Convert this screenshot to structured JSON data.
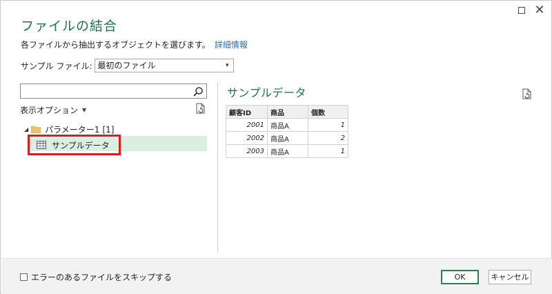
{
  "window": {
    "maximize_icon": "maximize-icon",
    "close_icon": "close-icon",
    "close_glyph": "✕"
  },
  "title": "ファイルの結合",
  "description": {
    "text": "各ファイルから抽出するオブジェクトを選びます。",
    "link": "詳細情報"
  },
  "sample_file": {
    "label": "サンプル ファイル:",
    "value": "最初のファイル",
    "caret": "▾"
  },
  "search": {
    "value": "",
    "placeholder": "",
    "icon": "search-icon"
  },
  "display_options": {
    "label": "表示オプション",
    "caret": "▼"
  },
  "tree": {
    "folder": {
      "label": "パラメーター1",
      "count": "[1]",
      "expand_glyph": "◢"
    },
    "item": {
      "label": "サンプルデータ",
      "selected": true
    }
  },
  "preview": {
    "title": "サンプルデータ",
    "columns": [
      "顧客ID",
      "商品",
      "個数"
    ],
    "rows": [
      [
        "2001",
        "商品A",
        "1"
      ],
      [
        "2002",
        "商品A",
        "2"
      ],
      [
        "2003",
        "商品A",
        "1"
      ]
    ]
  },
  "footer": {
    "skip_label": "エラーのあるファイルをスキップする",
    "skip_checked": false,
    "ok_label": "OK",
    "cancel_label": "キャンセル"
  },
  "colors": {
    "accent": "#217346",
    "highlight": "#dbeee2",
    "annotation": "#d32020",
    "link": "#2b6cb0"
  }
}
